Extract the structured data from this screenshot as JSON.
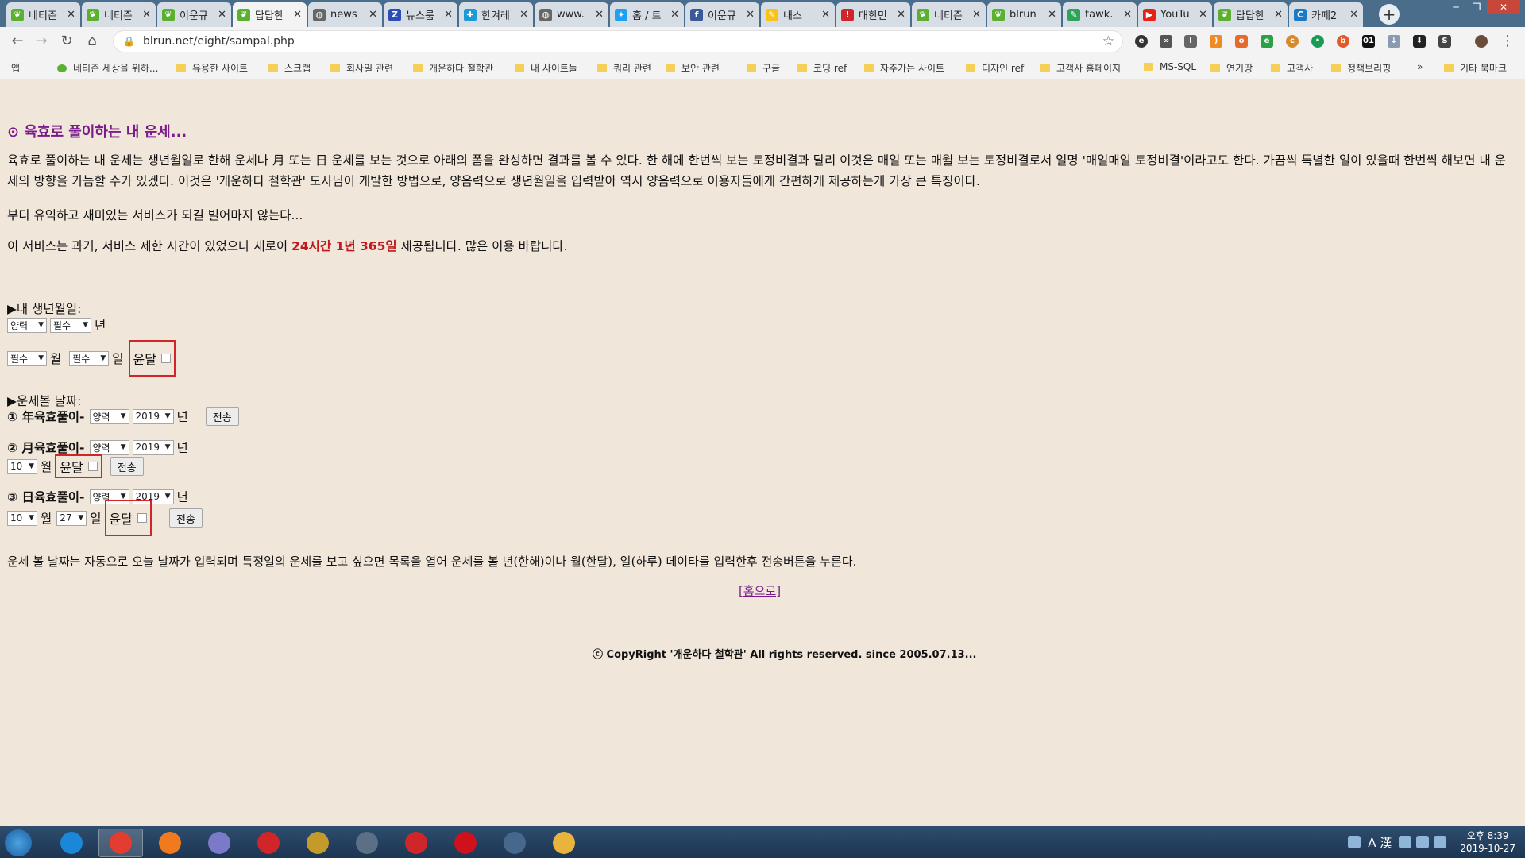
{
  "browser": {
    "tabs": [
      {
        "label": "네티즌",
        "fav": "leaf",
        "color": "#5bb12f"
      },
      {
        "label": "네티즌",
        "fav": "leaf",
        "color": "#5bb12f"
      },
      {
        "label": "이운규",
        "fav": "leaf",
        "color": "#5bb12f"
      },
      {
        "label": "답답한",
        "fav": "leaf",
        "color": "#5bb12f"
      },
      {
        "label": "news",
        "fav": "globe",
        "color": "#666666"
      },
      {
        "label": "뉴스룸",
        "fav": "Z",
        "color": "#2a4db7"
      },
      {
        "label": "한겨레",
        "fav": "pin",
        "color": "#1a9ad6"
      },
      {
        "label": "www.",
        "fav": "globe",
        "color": "#666666"
      },
      {
        "label": "홈 / 트",
        "fav": "bird",
        "color": "#1da1f2"
      },
      {
        "label": "이운규",
        "fav": "f",
        "color": "#3b5998"
      },
      {
        "label": "내스",
        "fav": "note",
        "color": "#f7c21a"
      },
      {
        "label": "대한민",
        "fav": "flag",
        "color": "#d0262a"
      },
      {
        "label": "네티즌",
        "fav": "leaf",
        "color": "#5bb12f"
      },
      {
        "label": "blrun",
        "fav": "leaf",
        "color": "#5bb12f"
      },
      {
        "label": "tawk.",
        "fav": "chat",
        "color": "#2fa35a"
      },
      {
        "label": "YouTu",
        "fav": "play",
        "color": "#e62117"
      },
      {
        "label": "답답한",
        "fav": "leaf",
        "color": "#5bb12f"
      },
      {
        "label": "카페2",
        "fav": "C",
        "color": "#1a7ac8"
      }
    ],
    "active_tab": 3,
    "url": "blrun.net/eight/sampal.php",
    "bookmarks": {
      "apps": "앱",
      "items": [
        "네티즌 세상을 위하...",
        "유용한 사이트",
        "스크랩",
        "회사일 관련",
        "개운하다 철학관",
        "내 사이트들",
        "쿼리 관련",
        "보안 관련",
        "구글",
        "코딩 ref",
        "자주가는 사이트",
        "디자인 ref",
        "고객사 홈페이지",
        "MS-SQL",
        "연기땅",
        "고객사",
        "정책브리핑"
      ],
      "more": "»",
      "other": "기타 북마크"
    }
  },
  "page": {
    "title": "⊙ 육효로 풀이하는 내 운세...",
    "desc": "육효로 풀이하는 내 운세는 생년월일로 한해 운세나 月 또는 日 운세를 보는 것으로 아래의 폼을 완성하면 결과를 볼 수 있다. 한 해에 한번씩 보는 토정비결과 달리 이것은 매일 또는 매월 보는 토정비결로서 일명 '매일매일 토정비결'이라고도 한다. 가끔씩 특별한 일이 있을때 한번씩 해보면 내 운세의 방향을 가늠할 수가 있겠다. 이것은 '개운하다 철학관' 도사님이 개발한 방법으로, 양음력으로 생년월일을 입력받아 역시 양음력으로 이용자들에게 간편하게 제공하는게 가장 큰 특징이다.",
    "wish": "부디 유익하고 재미있는 서비스가 되길 빌어마지 않는다...",
    "service_pre": "이 서비스는 과거, 서비스 제한 시간이 있었으나 새로이 ",
    "service_hl": "24시간 1년 365일",
    "service_post": " 제공됩니다. 많은 이용 바랍니다.",
    "birth_header": "▶내 생년월일:",
    "birth": {
      "cal": "양력",
      "year": "필수",
      "year_unit": "년",
      "month": "필수",
      "month_unit": "월",
      "day": "필수",
      "day_unit": "일",
      "leap": "윤달"
    },
    "fortune_header": "▶운세볼 날짜:",
    "yearly": {
      "label": "① 年육효풀이-",
      "cal": "양력",
      "year": "2019",
      "year_unit": "년",
      "submit": "전송"
    },
    "monthly": {
      "label": "② 月육효풀이-",
      "cal": "양력",
      "year": "2019",
      "year_unit": "년",
      "month": "10",
      "month_unit": "월",
      "leap": "윤달",
      "submit": "전송"
    },
    "daily": {
      "label": "③ 日육효풀이-",
      "cal": "양력",
      "year": "2019",
      "year_unit": "년",
      "month": "10",
      "month_unit": "월",
      "day": "27",
      "day_unit": "일",
      "leap": "윤달",
      "submit": "전송"
    },
    "note": "운세 볼 날짜는 자동으로 오늘 날짜가 입력되며 특정일의 운세를 보고 싶으면 목록을 열어 운세를 볼 년(한해)이나 월(한달), 일(하루) 데이타를 입력한후 전송버튼을 누른다.",
    "home": "[홈으로]",
    "copyright": "ⓒ CopyRight '개운하다 철학관' All rights reserved. since 2005.07.13..."
  },
  "taskbar": {
    "apps": [
      "ie",
      "chrome",
      "firefox",
      "s-app",
      "opera",
      "pen-tool",
      "book",
      "pokeball",
      "record",
      "tree",
      "folder"
    ],
    "app_colors": [
      "#1a87d8",
      "#e23d2f",
      "#f07a1d",
      "#7a7ac8",
      "#d0262a",
      "#c49a2a",
      "#5b6f86",
      "#d0262a",
      "#d0101a",
      "#46688c",
      "#e9b43c"
    ],
    "ime": "A 漢",
    "time": "오후 8:39",
    "date": "2019-10-27"
  }
}
